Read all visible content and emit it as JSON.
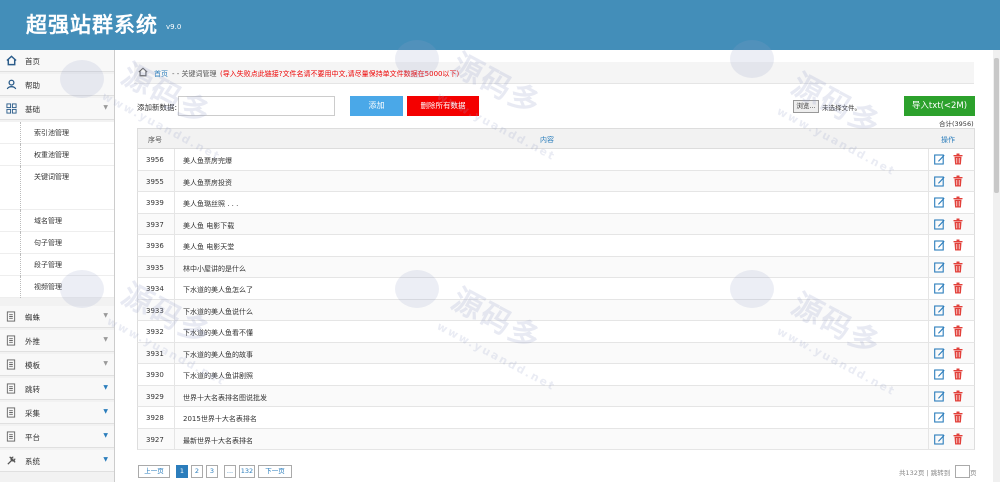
{
  "header": {
    "title": "超强站群系统",
    "version": "v9.0"
  },
  "sidebar": {
    "items": [
      {
        "label": "首页",
        "icon": "home-icon"
      },
      {
        "label": "帮助",
        "icon": "user-icon"
      },
      {
        "label": "基础",
        "icon": "grid-icon"
      },
      {
        "label": "蜘蛛",
        "icon": "doc-icon"
      },
      {
        "label": "外推",
        "icon": "doc-icon"
      },
      {
        "label": "模板",
        "icon": "doc-icon"
      },
      {
        "label": "跳转",
        "icon": "doc-icon"
      },
      {
        "label": "采集",
        "icon": "doc-icon"
      },
      {
        "label": "平台",
        "icon": "doc-icon"
      },
      {
        "label": "系统",
        "icon": "tools-icon"
      }
    ],
    "sub_items": [
      "索引池管理",
      "权重池管理",
      "关键词管理",
      "域名管理",
      "句子管理",
      "段子管理",
      "视频管理"
    ]
  },
  "breadcrumb": {
    "home": "首页",
    "current": "- - 关键词管理",
    "note": "(导入失败点此链接?文件名请不要用中文,请尽量保持单文件数据在5000以下)"
  },
  "toolbar": {
    "add_label": "添加新数据:",
    "add_button": "添加",
    "delete_all_button": "删除所有数据",
    "browse_button": "浏览...",
    "no_file": "未选择文件。",
    "import_button": "导入txt(<2M)",
    "total": "合计(3956)"
  },
  "table": {
    "headers": {
      "num": "序号",
      "content": "内容",
      "op": "操作"
    },
    "rows": [
      {
        "num": "3956",
        "text": "美人鱼票房完爆"
      },
      {
        "num": "3955",
        "text": "美人鱼票房投资"
      },
      {
        "num": "3939",
        "text": "美人鱼璐丝照 . . ."
      },
      {
        "num": "3937",
        "text": "美人鱼 电影下载"
      },
      {
        "num": "3936",
        "text": "美人鱼 电影天堂"
      },
      {
        "num": "3935",
        "text": "林中小屋讲的是什么"
      },
      {
        "num": "3934",
        "text": "下水道的美人鱼怎么了"
      },
      {
        "num": "3933",
        "text": "下水道的美人鱼说什么"
      },
      {
        "num": "3932",
        "text": "下水道的美人鱼看不懂"
      },
      {
        "num": "3931",
        "text": "下水道的美人鱼的故事"
      },
      {
        "num": "3930",
        "text": "下水道的美人鱼讲剧照"
      },
      {
        "num": "3929",
        "text": "世界十大名表排名图说批发"
      },
      {
        "num": "3928",
        "text": "2015世界十大名表排名"
      },
      {
        "num": "3927",
        "text": "最新世界十大名表排名"
      }
    ]
  },
  "pager": {
    "prev": "上一页",
    "p1": "1",
    "p2": "2",
    "p3": "3",
    "ellipsis": "...",
    "last": "132",
    "next": "下一页",
    "total": "共132页 | 跳转到",
    "suffix": "页"
  },
  "watermark": {
    "main": "源码多",
    "sub": "www.yuandd.net"
  },
  "colors": {
    "header": "#438eb9",
    "add": "#4aa8e8",
    "delete": "#f40000",
    "import": "#2ca12c",
    "link": "#2b7dbc"
  }
}
